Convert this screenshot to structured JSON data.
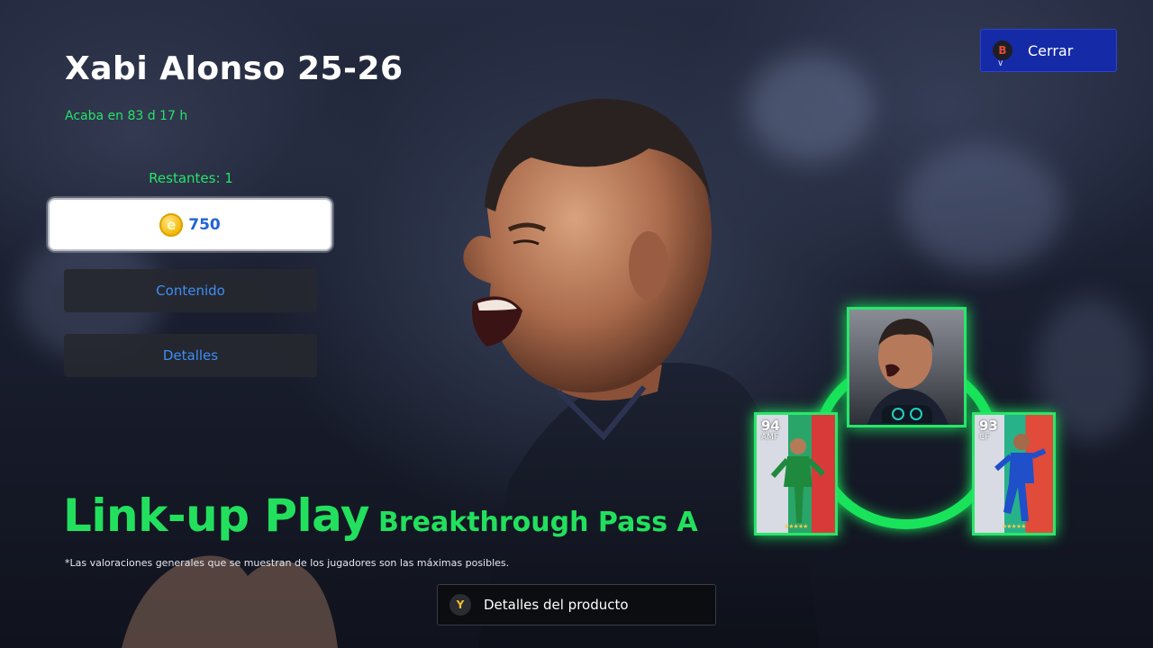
{
  "header": {
    "title": "Xabi Alonso 25-26",
    "timer": "Acaba en 83 d 17 h"
  },
  "purchase": {
    "remaining": "Restantes: 1",
    "coin_symbol": "e",
    "price": "750"
  },
  "menu": {
    "contents_label": "Contenido",
    "details_label": "Detalles"
  },
  "close_button": {
    "key": "B",
    "label": "Cerrar"
  },
  "campaign": {
    "skill": "Link-up Play",
    "sub_skill": "Breakthrough Pass A",
    "disclaimer": "*Las valoraciones generales que se muestran de los jugadores son las máximas posibles."
  },
  "product_details_button": {
    "key": "Y",
    "label": "Detalles del producto"
  },
  "link_up": {
    "left_card": {
      "rating": "94",
      "position": "AMF",
      "stars": "★★★★★"
    },
    "right_card": {
      "rating": "93",
      "position": "CF",
      "stars": "★★★★★"
    }
  },
  "colors": {
    "accent_green": "#22e05d",
    "close_blue": "#152aa6",
    "link_blue": "#3d8ef5"
  }
}
